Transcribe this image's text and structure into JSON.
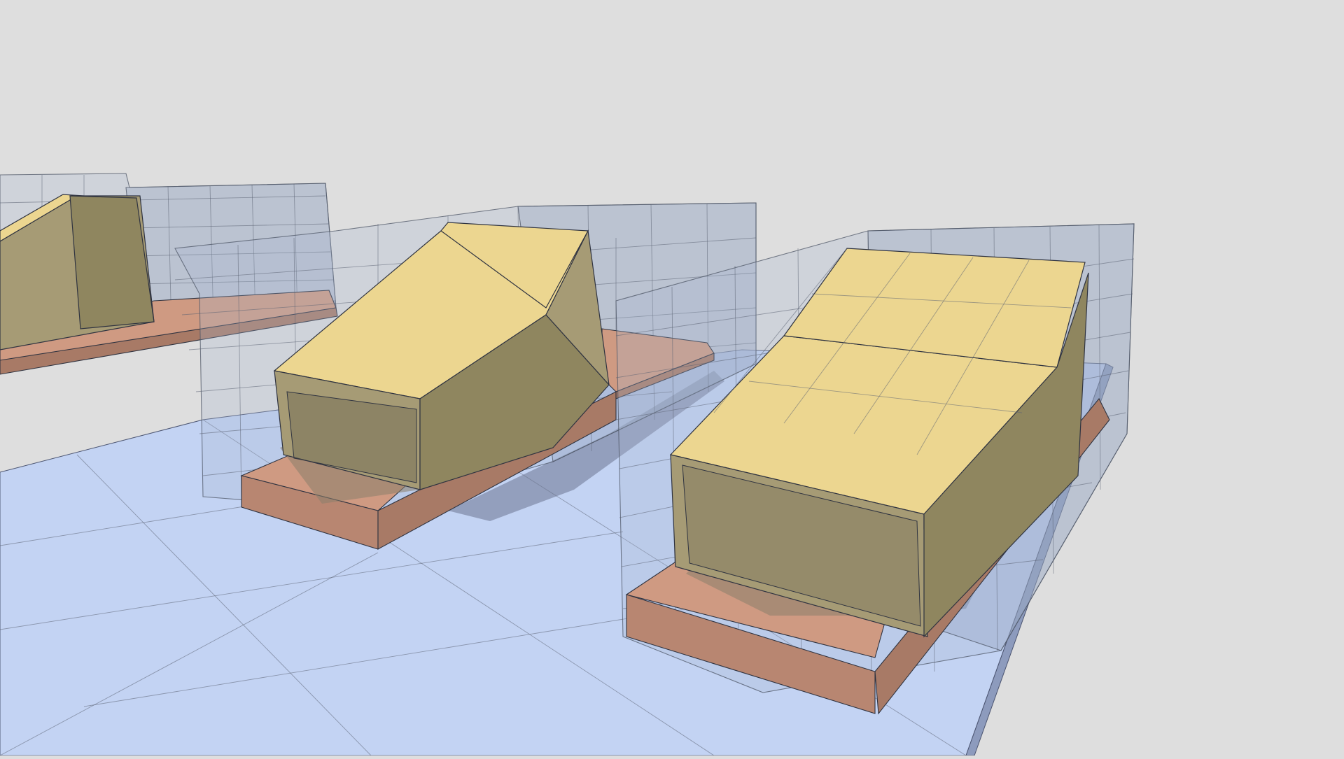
{
  "scene": {
    "background_color": "#dedede",
    "ground_color": "#c3d3f3",
    "volume_color": "#ecd690",
    "slab_color": "#cf9a82",
    "glass_color": "#a9b8d2",
    "modules": [
      {
        "id": "module-1",
        "partially_visible": true
      },
      {
        "id": "module-2",
        "partially_visible": false
      },
      {
        "id": "module-3",
        "partially_visible": false
      }
    ]
  }
}
